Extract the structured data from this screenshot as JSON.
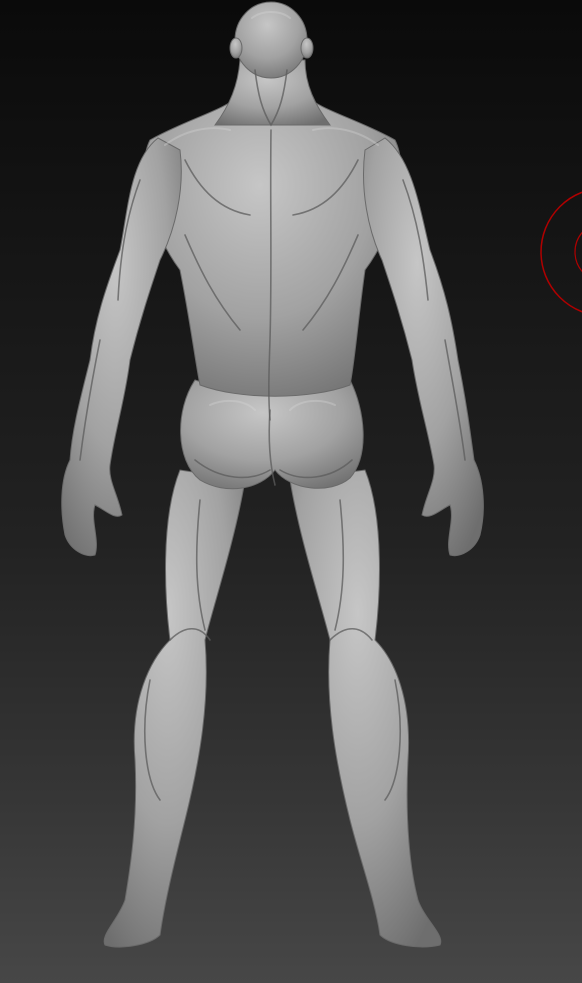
{
  "viewport": {
    "background_top": "#0a0a0a",
    "background_bottom": "#474747",
    "model_color": "#a8a8a8"
  },
  "model": {
    "name": "clay-figure",
    "view": "back"
  },
  "brush_cursor": {
    "color": "#b00000"
  }
}
